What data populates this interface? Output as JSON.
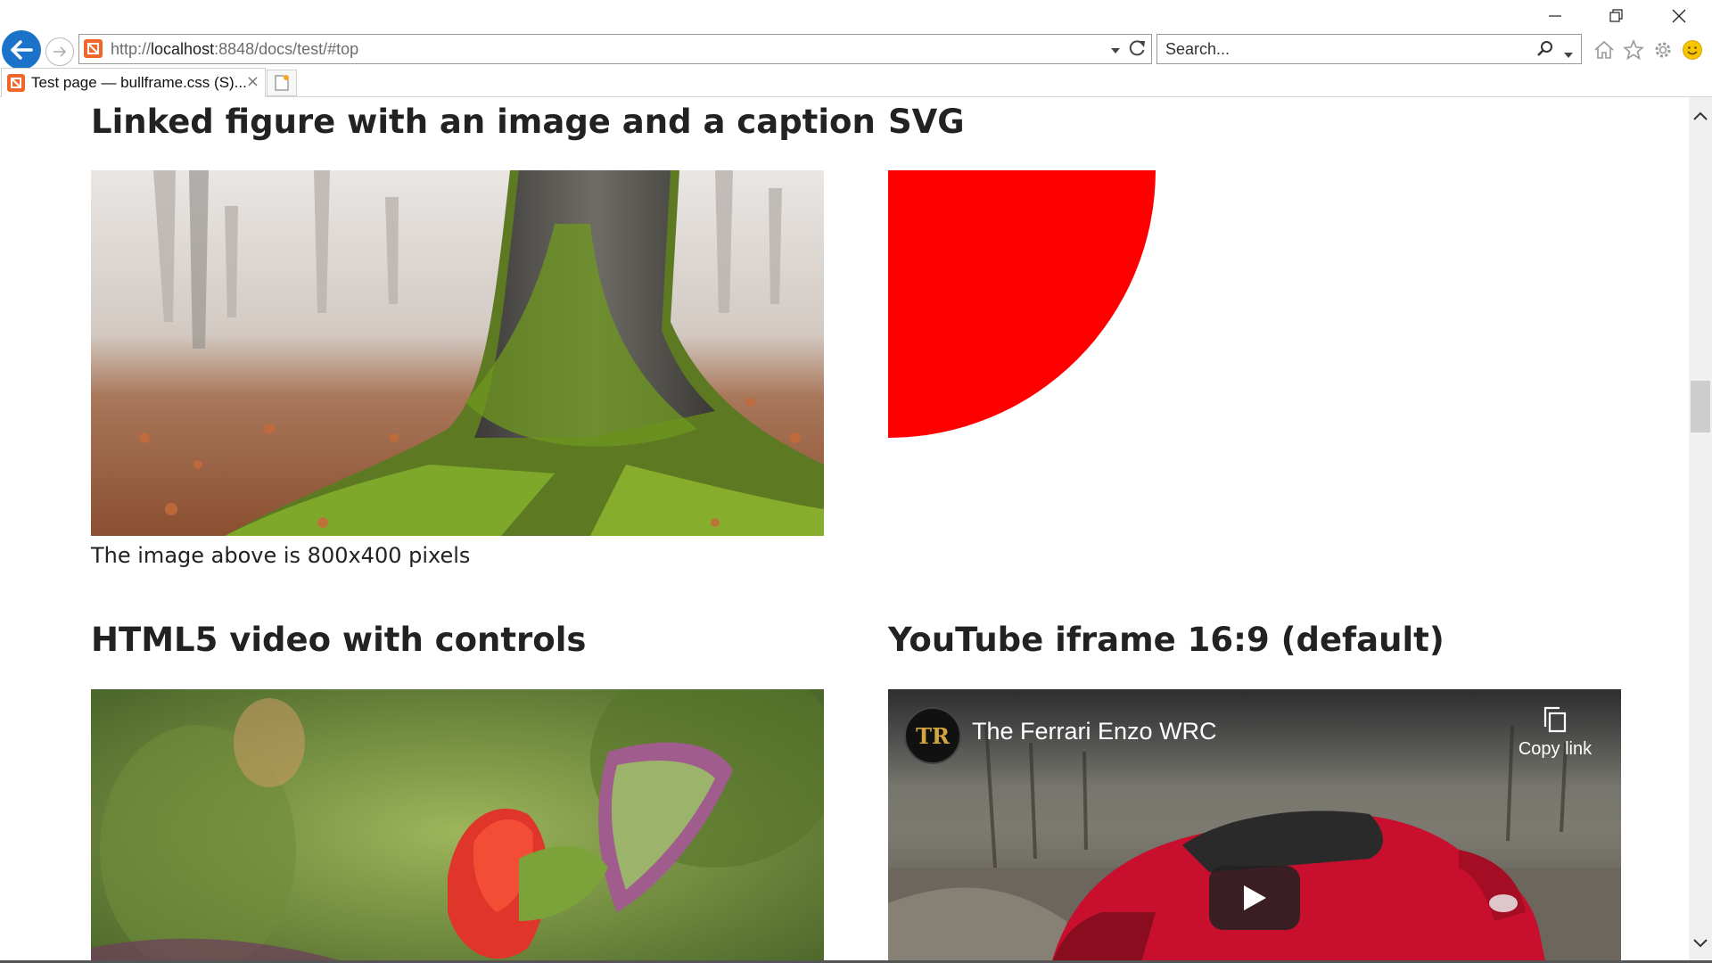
{
  "browser": {
    "address": {
      "prefix": "http://",
      "host": "localhost",
      "path": ":8848/docs/test/#top"
    },
    "search_placeholder": "Search...",
    "tab": {
      "title": "Test page — bullframe.css (S)...",
      "close": "×"
    }
  },
  "page": {
    "figure_section": {
      "heading": "Linked figure with an image and a caption",
      "caption": "The image above is 800x400 pixels"
    },
    "svg_section": {
      "heading": "SVG",
      "shape_color": "#ff0000"
    },
    "video_section": {
      "heading": "HTML5 video with controls"
    },
    "youtube_section": {
      "heading": "YouTube iframe 16:9 (default)",
      "video_title": "The Ferrari Enzo WRC",
      "channel_initials": "TR",
      "copy_link_label": "Copy link"
    }
  },
  "colors": {
    "accent": "#1a73c8",
    "favicon": "#f1662a"
  }
}
